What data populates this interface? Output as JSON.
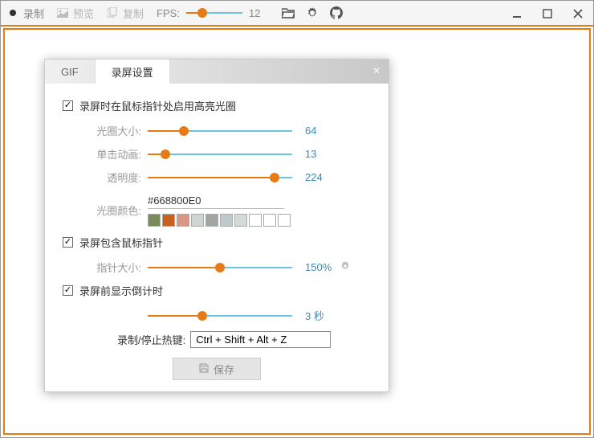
{
  "titlebar": {
    "record": "录制",
    "preview": "预览",
    "copy": "复制",
    "fps_label": "FPS:",
    "fps_value": "12"
  },
  "dialog": {
    "tabs": {
      "gif": "GIF",
      "settings": "录屏设置"
    },
    "close": "×",
    "highlight": {
      "label": "录屏时在鼠标指针处启用高亮光圈",
      "ring_size_label": "光圈大小:",
      "ring_size_value": "64",
      "click_anim_label": "单击动画:",
      "click_anim_value": "13",
      "opacity_label": "透明度:",
      "opacity_value": "224",
      "color_label": "光圈颜色:",
      "color_value": "#668800E0"
    },
    "cursor": {
      "label": "录屏包含鼠标指针",
      "size_label": "指针大小:",
      "size_value": "150%"
    },
    "countdown": {
      "label": "录屏前显示倒计时",
      "value": "3 秒"
    },
    "hotkey": {
      "label": "录制/停止热键:",
      "value": "Ctrl + Shift + Alt + Z"
    },
    "save": "保存"
  },
  "swatches": [
    "#7A8A5A",
    "#C8601E",
    "#D99686",
    "#CED5D0",
    "#A0A7A2",
    "#BEC9CD",
    "#D2DBD7",
    "#FFFFFF",
    "#FFFFFF",
    "#FFFFFF"
  ],
  "sliders": {
    "ring_size": 25,
    "click_anim": 12,
    "opacity": 88,
    "cursor_size": 50,
    "countdown": 38
  }
}
